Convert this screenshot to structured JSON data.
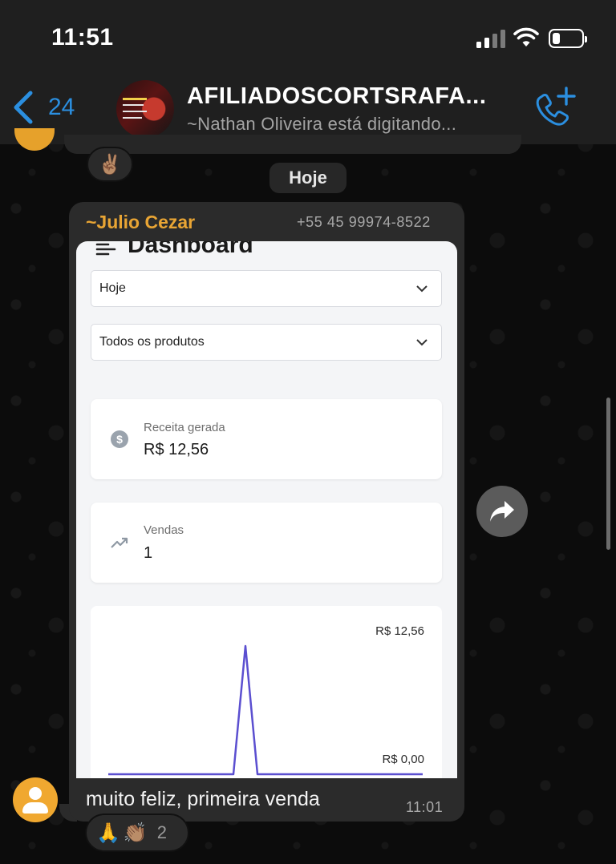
{
  "status_bar": {
    "time": "11:51"
  },
  "header": {
    "back_count": "24",
    "group_name": "AFILIADOSCORTSRAFA...",
    "subtitle": "~Nathan Oliveira está digitando..."
  },
  "previous_message": {
    "reaction": "✌🏽"
  },
  "date_chip": "Hoje",
  "message": {
    "sender": "~Julio Cezar",
    "phone": "+55 45 99974-8522",
    "caption": "muito feliz, primeira venda",
    "time": "11:01",
    "reactions": {
      "emoji_1": "🙏",
      "emoji_2": "👏🏽",
      "count": "2"
    }
  },
  "dashboard": {
    "title": "Dashboard",
    "period_select": "Hoje",
    "product_select": "Todos os produtos",
    "revenue": {
      "label": "Receita gerada",
      "value": "R$ 12,56"
    },
    "sales": {
      "label": "Vendas",
      "value": "1"
    },
    "chart_top_label": "R$ 12,56",
    "chart_bottom_label": "R$ 0,00"
  },
  "colors": {
    "accent_blue": "#2b8fe0",
    "sender_orange": "#e9a534",
    "chart_line": "#5b4fd0"
  }
}
